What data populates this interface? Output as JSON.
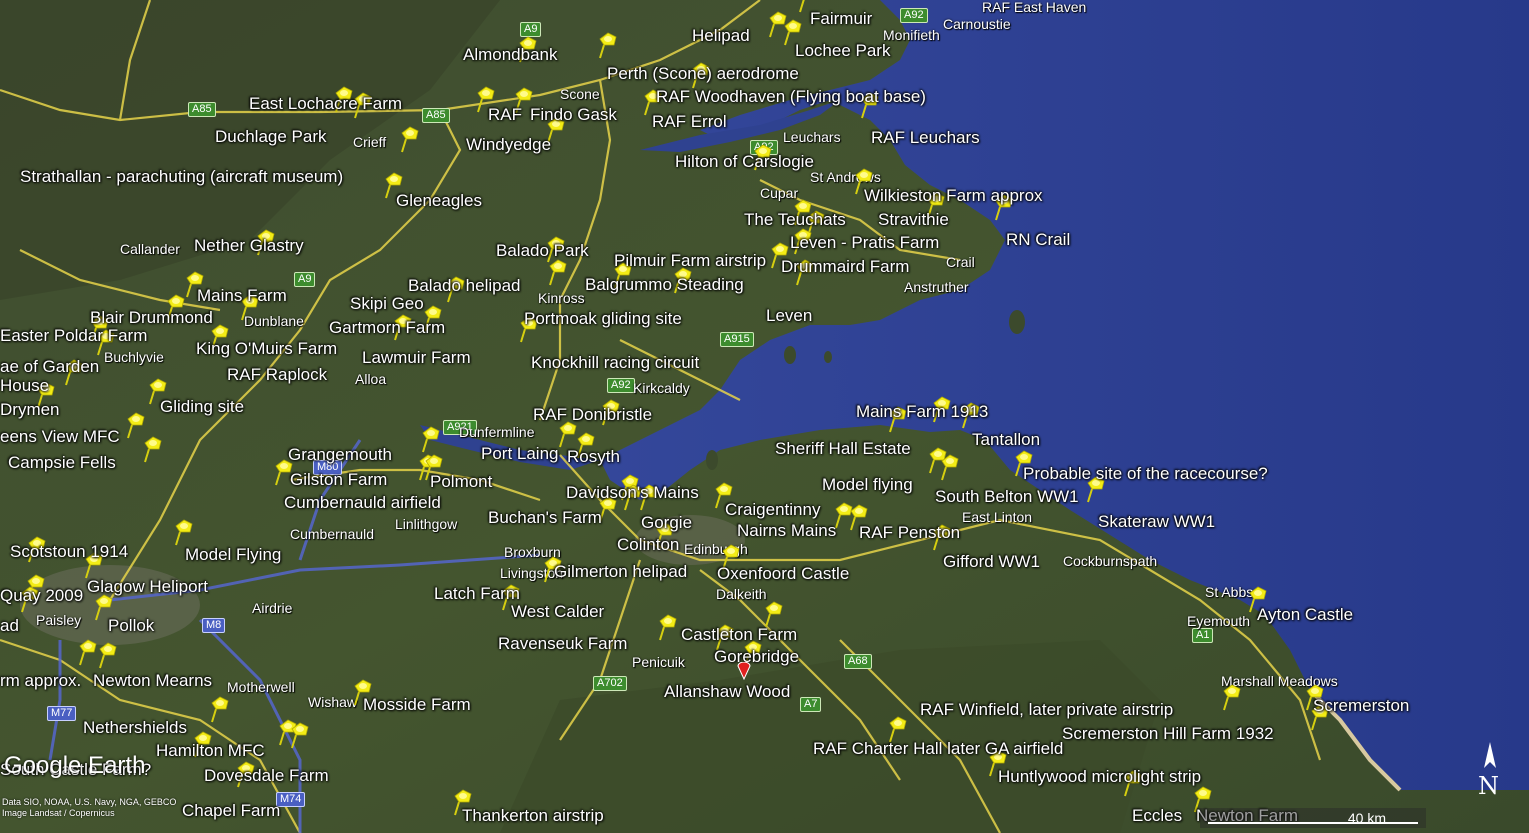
{
  "app": {
    "logo": "Google Earth"
  },
  "credits": [
    "Data SIO, NOAA, U.S. Navy, NGA, GEBCO",
    "Image Landsat / Copernicus"
  ],
  "scale": {
    "label": "40 km"
  },
  "compass": {
    "label": "N"
  },
  "colors": {
    "sea": "#2c3f8f",
    "land": "#3b4a2c",
    "pin": "#f3ec16",
    "road": "#e9d54a",
    "motorway": "#4a5fc2"
  },
  "placemarks": [
    {
      "name": "Fairmuir"
    },
    {
      "name": "Helipad"
    },
    {
      "name": "Lochee Park"
    },
    {
      "name": "Almondbank"
    },
    {
      "name": "Perth (Scone) aerodrome"
    },
    {
      "name": "RAF Woodhaven (Flying boat base)"
    },
    {
      "name": "East Lochacre Farm"
    },
    {
      "name": "RAF"
    },
    {
      "name": "Findo Gask"
    },
    {
      "name": "RAF Errol"
    },
    {
      "name": "RAF Leuchars"
    },
    {
      "name": "Duchlage Park"
    },
    {
      "name": "Windyedge"
    },
    {
      "name": "Hilton of Carslogie"
    },
    {
      "name": "Strathallan - parachuting (aircraft museum)"
    },
    {
      "name": "Wilkieston Farm approx"
    },
    {
      "name": "Gleneagles"
    },
    {
      "name": "The Teuchats"
    },
    {
      "name": "Stravithie"
    },
    {
      "name": "RN Crail"
    },
    {
      "name": "Leven - Pratis Farm"
    },
    {
      "name": "Nether Glastry"
    },
    {
      "name": "Balado Park"
    },
    {
      "name": "Pilmuir Farm airstrip"
    },
    {
      "name": "Drummaird Farm"
    },
    {
      "name": "Balado helipad"
    },
    {
      "name": "Balgrummo Steading"
    },
    {
      "name": "Mains Farm"
    },
    {
      "name": "Skipi Geo"
    },
    {
      "name": "Blair Drummond"
    },
    {
      "name": "Portmoak gliding site"
    },
    {
      "name": "Leven"
    },
    {
      "name": "Gartmorn Farm"
    },
    {
      "name": "Easter Poldar Farm"
    },
    {
      "name": "King O'Muirs Farm"
    },
    {
      "name": "Lawmuir Farm"
    },
    {
      "name": "Knockhill racing circuit"
    },
    {
      "name": "ae of Garden"
    },
    {
      "name": "RAF Raplock"
    },
    {
      "name": "House"
    },
    {
      "name": "Drymen"
    },
    {
      "name": "Gliding site"
    },
    {
      "name": "RAF Donibristle"
    },
    {
      "name": "Mains Farm 1913"
    },
    {
      "name": "eens View MFC"
    },
    {
      "name": "Tantallon"
    },
    {
      "name": "Sheriff Hall Estate"
    },
    {
      "name": "Grangemouth"
    },
    {
      "name": "Port Laing"
    },
    {
      "name": "Rosyth"
    },
    {
      "name": "Campsie Fells"
    },
    {
      "name": "Probable site of the racecourse?"
    },
    {
      "name": "Gilston Farm"
    },
    {
      "name": "Polmont"
    },
    {
      "name": "Model flying"
    },
    {
      "name": "South Belton WW1"
    },
    {
      "name": "Davidson's Mains"
    },
    {
      "name": "Cumbernauld airfield"
    },
    {
      "name": "Craigentinny"
    },
    {
      "name": "Skateraw WW1"
    },
    {
      "name": "Buchan's Farm"
    },
    {
      "name": "Gorgie"
    },
    {
      "name": "Nairns Mains"
    },
    {
      "name": "RAF Penston"
    },
    {
      "name": "Colinton"
    },
    {
      "name": "Scotstoun 1914"
    },
    {
      "name": "Model Flying"
    },
    {
      "name": "Gifford WW1"
    },
    {
      "name": "Glagow Heliport"
    },
    {
      "name": "Gilmerton helipad"
    },
    {
      "name": "Oxenfoord Castle"
    },
    {
      "name": "Quay 2009"
    },
    {
      "name": "Latch Farm"
    },
    {
      "name": "West Calder"
    },
    {
      "name": "Ayton Castle"
    },
    {
      "name": "Pollok"
    },
    {
      "name": "ad"
    },
    {
      "name": "Ravenseuk Farm"
    },
    {
      "name": "Castleton Farm"
    },
    {
      "name": "Gorebridge"
    },
    {
      "name": "rm approx."
    },
    {
      "name": "Newton Mearns"
    },
    {
      "name": "Allanshaw Wood"
    },
    {
      "name": "Mosside Farm"
    },
    {
      "name": "RAF Winfield, later private airstrip"
    },
    {
      "name": "Scremerston"
    },
    {
      "name": "Nethershields"
    },
    {
      "name": "Scremerston Hill Farm 1932"
    },
    {
      "name": "Hamilton MFC"
    },
    {
      "name": "RAF Charter Hall later GA airfield"
    },
    {
      "name": "Dovesdale Farm"
    },
    {
      "name": "Huntlywood microlight strip"
    },
    {
      "name": "Chapel Farm"
    },
    {
      "name": "Thankerton airstrip"
    },
    {
      "name": "Eccles"
    },
    {
      "name": "Newton Farm"
    },
    {
      "name": "South Castle Farm?"
    }
  ],
  "towns": [
    "Carnoustie",
    "Monifieth",
    "Scone",
    "Crieff",
    "Leuchars",
    "Cupar",
    "St Andrews",
    "Callander",
    "Kinross",
    "Crail",
    "Anstruther",
    "Dunblane",
    "Buchlyvie",
    "Alloa",
    "Kirkcaldy",
    "Dunfermline",
    "Linlithgow",
    "Cumbernauld",
    "Broxburn",
    "Livingston",
    "Edinburgh",
    "East Linton",
    "Cockburnspath",
    "Dalkeith",
    "St Abbs",
    "Eyemouth",
    "Paisley",
    "Airdrie",
    "Penicuik",
    "Marshall Meadows",
    "Motherwell",
    "Wishaw",
    "RAF East Haven"
  ],
  "roads": [
    "A9",
    "A92",
    "A85",
    "A85",
    "A92",
    "A9",
    "A915",
    "A92",
    "A921",
    "M80",
    "M8",
    "A1",
    "A68",
    "A702",
    "A7",
    "M77",
    "M74"
  ]
}
